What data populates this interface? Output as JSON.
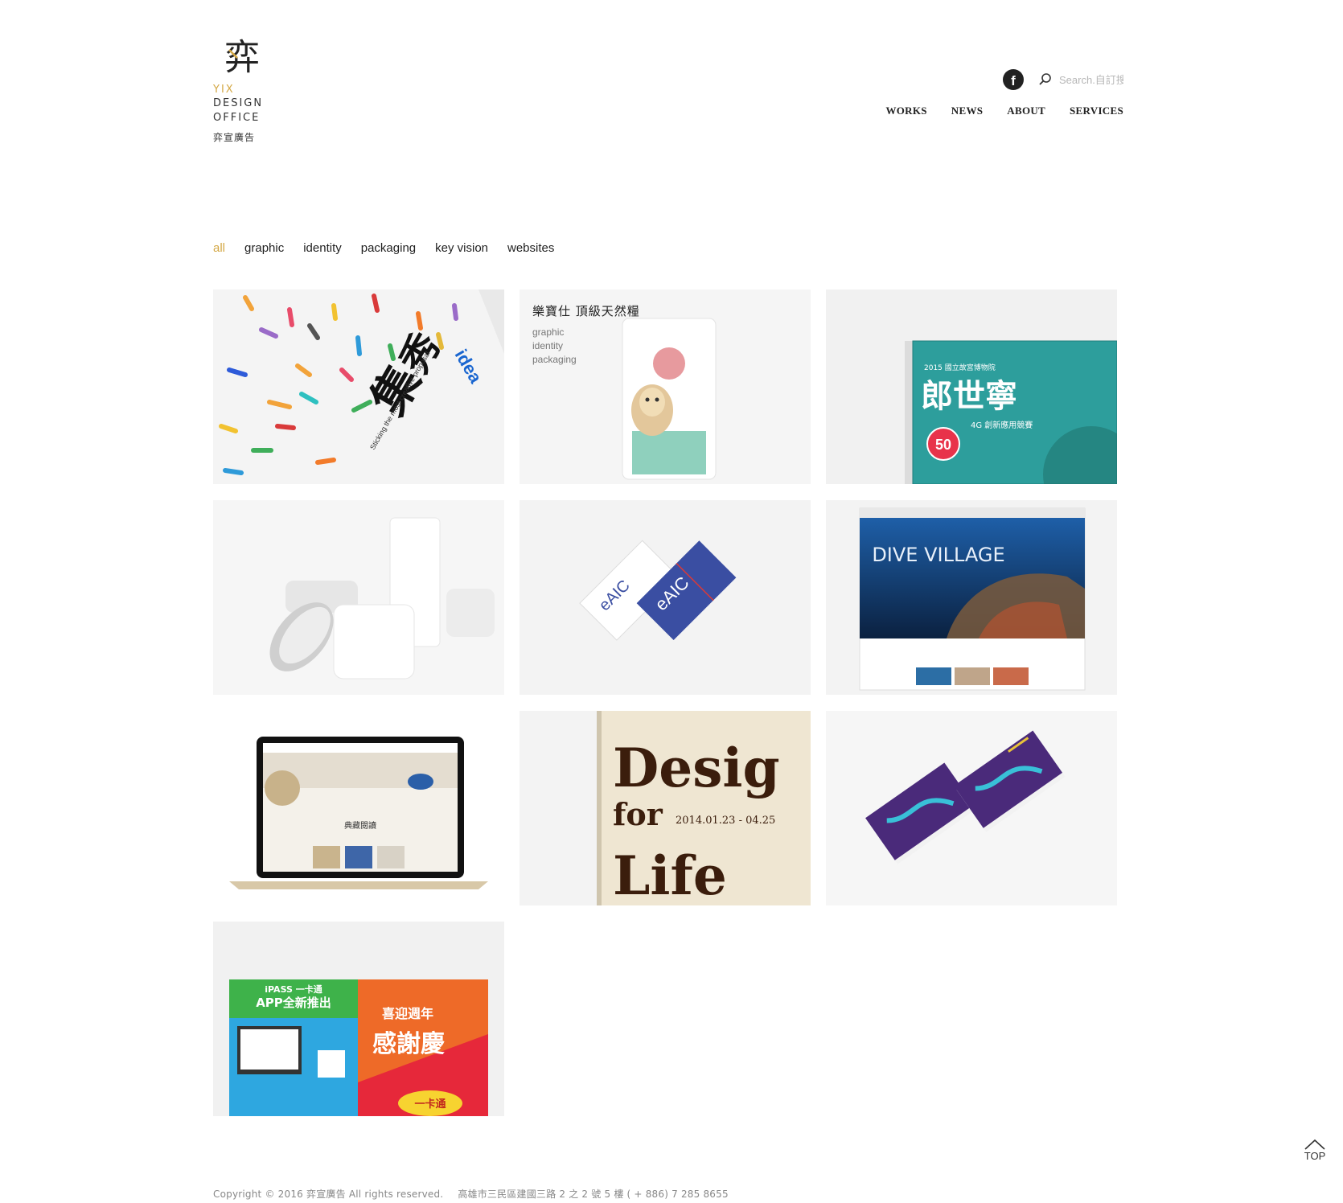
{
  "brand": {
    "logo_glyph": "弈",
    "line1": "YIX",
    "line2": "DESIGN",
    "line3": "OFFICE",
    "name_cn": "弈宣廣告",
    "accent_color": "#d4a845"
  },
  "header": {
    "facebook_icon": "facebook-icon",
    "search_placeholder": "Search.自訂搜",
    "nav": [
      {
        "label": "WORKS"
      },
      {
        "label": "NEWS"
      },
      {
        "label": "ABOUT"
      },
      {
        "label": "SERVICES"
      }
    ]
  },
  "filters": [
    {
      "label": "all",
      "active": true
    },
    {
      "label": "graphic"
    },
    {
      "label": "identity"
    },
    {
      "label": "packaging"
    },
    {
      "label": "key vision"
    },
    {
      "label": "websites"
    }
  ],
  "works": [
    {
      "image": "colorful pencils poster"
    },
    {
      "image": "pet food package",
      "title": "樂寶仕 頂級天然糧",
      "tags": [
        "graphic",
        "identity",
        "packaging"
      ]
    },
    {
      "image": "teal magazine cover",
      "cover_cn": "郎世寧",
      "cover_top": "2015 國立故宮博物院",
      "cover_sub": "4G 創新應用競賽",
      "badge": "50"
    },
    {
      "image": "white cosmetic products"
    },
    {
      "image": "blue business cards",
      "mark": "eAIC"
    },
    {
      "image": "dive village website",
      "heading": "DIVE VILLAGE"
    },
    {
      "image": "laptop museum website",
      "screen_heading": "典藏閱讀"
    },
    {
      "image": "design for life poster",
      "headline_a": "Desig",
      "headline_b": "for",
      "headline_c": "Life",
      "date": "2014.01.23 - 04.25"
    },
    {
      "image": "purple flyers"
    },
    {
      "image": "ipass flyers",
      "left_head": "iPASS 一卡通",
      "left_sub": "APP全新推出",
      "right_head": "喜迎週年",
      "right_big": "感謝慶",
      "right_tag": "一卡通"
    }
  ],
  "footer": {
    "copyright": "Copyright © 2016 弈宣廣告 All rights reserved.",
    "address": "高雄市三民區建國三路 2 之 2 號 5 樓 ( + 886) 7 285 8655"
  },
  "back_to_top": {
    "label": "TOP"
  }
}
